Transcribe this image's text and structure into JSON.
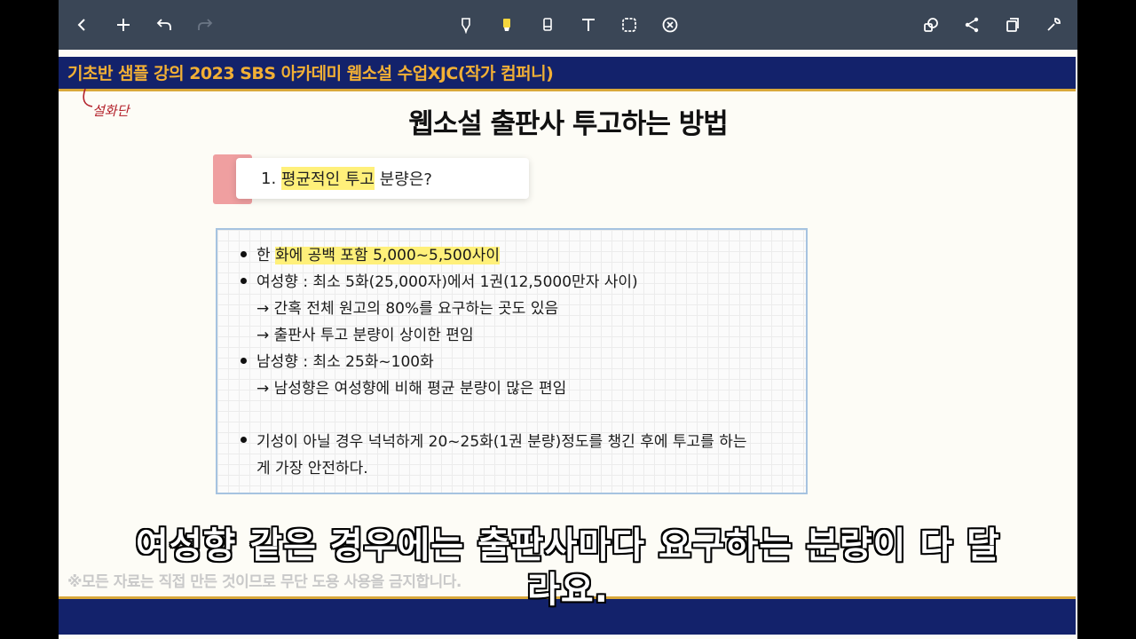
{
  "toolbar": {
    "icons": [
      "back-icon",
      "add-icon",
      "undo-icon",
      "redo-icon",
      "pen-icon",
      "highlighter-icon",
      "eraser-icon",
      "text-icon",
      "shape-icon",
      "close-circle-icon",
      "lasso-icon",
      "share-icon",
      "pages-icon",
      "settings-icon"
    ]
  },
  "slide": {
    "band_title": "기초반 샘플 강의  2023 SBS 아카데미 웹소설 수업XJC(작가 컴퍼니)",
    "handwriting": "설화단",
    "title": "웹소설 출판사 투고하는 방법",
    "question_prefix": "1. ",
    "question_highlight": "평균적인 투고",
    "question_suffix": " 분량은?",
    "lines": {
      "l1_pre": "한 ",
      "l1_hl": "화에 공백 포함 5,000~5,500사이",
      "l2": "여성향 : 최소 5화(25,000자)에서 1권(12,5000만자 사이)",
      "l3": "→ 간혹 전체 원고의 80%를 요구하는 곳도 있음",
      "l4": "→ 출판사 투고 분량이 상이한 편임",
      "l5": "남성향 : 최소 25화~100화",
      "l6": "→ 남성향은 여성향에 비해 평균 분량이 많은 편임",
      "l7": "기성이 아닐 경우 넉넉하게 20~25화(1권 분량)정도를 챙긴 후에 투고를 하는",
      "l8": "게 가장 안전하다."
    },
    "copyright": "※모든 자료는 직접 만든 것이므로 무단 도용 사용을 금지합니다."
  },
  "subtitles": {
    "line1": "여성향 같은 경우에는 출판사마다 요구하는 분량이 다 달",
    "line2": "라요."
  }
}
